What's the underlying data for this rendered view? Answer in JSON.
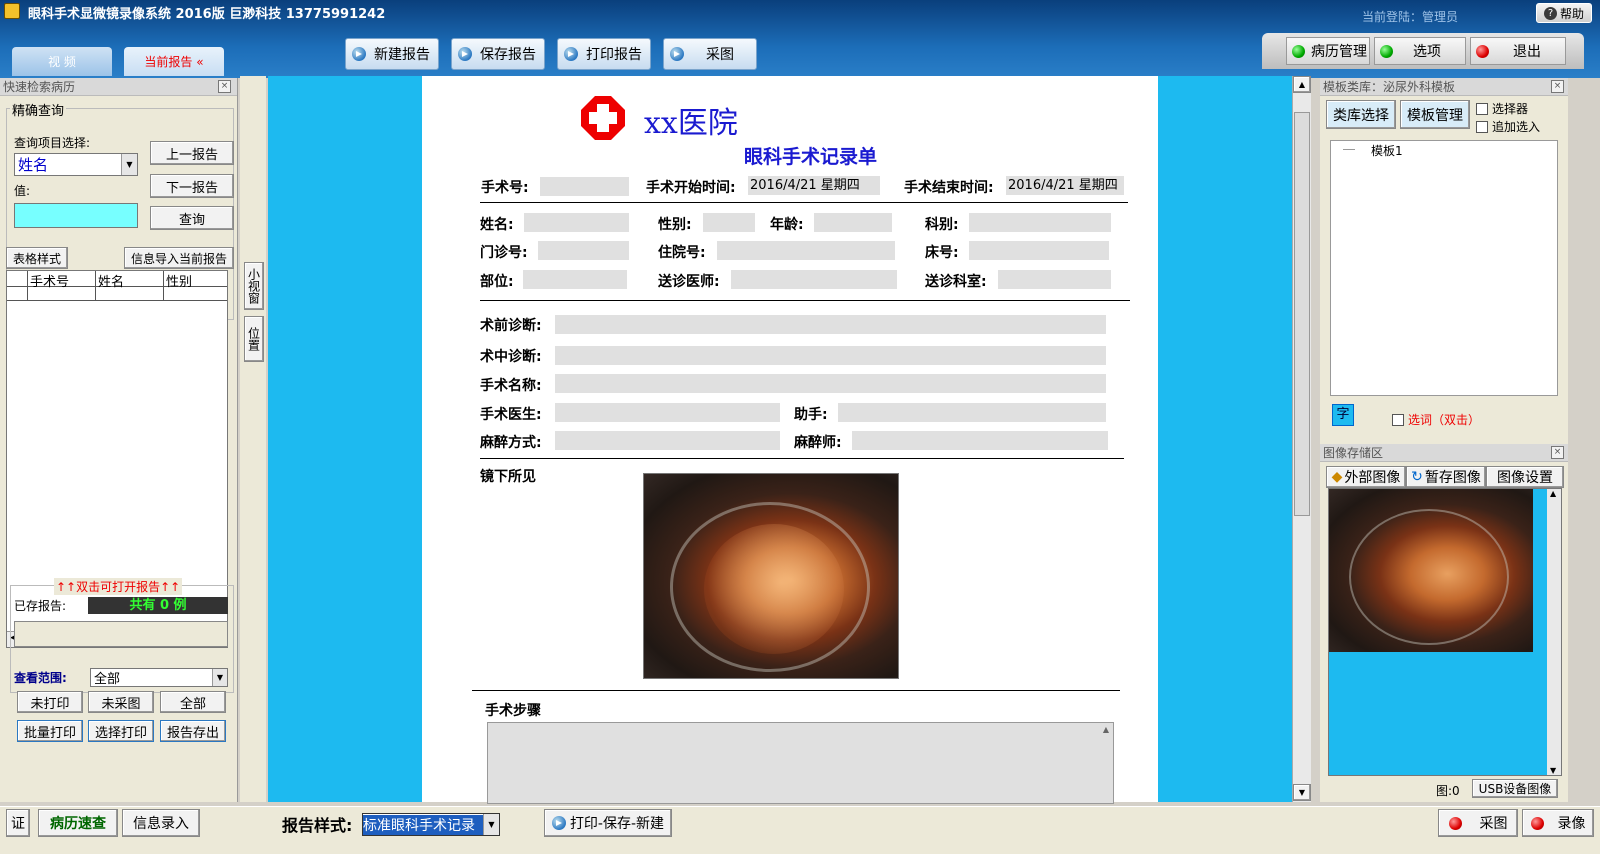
{
  "app": {
    "title": "眼科手术显微镜录像系统  2016版    巨渺科技    13775991242",
    "login": "当前登陆：管理员",
    "help": "帮助"
  },
  "tabs": {
    "video": "视 频",
    "current_report": "当前报告 «"
  },
  "toolbar": {
    "new_report": "新建报告",
    "save_report": "保存报告",
    "print_report": "打印报告",
    "capture": "采图"
  },
  "right_top": {
    "records": "病历管理",
    "options": "选项",
    "exit": "退出"
  },
  "left": {
    "title": "快速检索病历",
    "precise": "精确查询",
    "query_item_label": "查询项目选择:",
    "query_item_value": "姓名",
    "value_label": "值:",
    "prev": "上一报告",
    "next": "下一报告",
    "query": "查询",
    "table_style": "表格样式",
    "import_info": "信息导入当前报告",
    "columns": [
      "手术号",
      "姓名",
      "性别"
    ],
    "dblclick_hint": "↑↑双击可打开报告↑↑",
    "saved_label": "已存报告:",
    "saved_count": "共有 0 例",
    "scope_label": "查看范围:",
    "scope_value": "全部",
    "not_printed": "未打印",
    "not_captured": "未采图",
    "all": "全部",
    "batch_print": "批量打印",
    "select_print": "选择打印",
    "export": "报告存出"
  },
  "side_tabs": {
    "small_window": "小视窗",
    "position": "位置"
  },
  "report": {
    "hospital": "xx医院",
    "form_title": "眼科手术记录单",
    "surgery_no": "手术号:",
    "start_time_label": "手术开始时间:",
    "start_time": "2016/4/21  星期四",
    "end_time_label": "手术结束时间:",
    "end_time": "2016/4/21  星期四",
    "name": "姓名:",
    "gender": "性别:",
    "age": "年龄:",
    "dept": "科别:",
    "outpatient_no": "门诊号:",
    "inpatient_no": "住院号:",
    "bed_no": "床号:",
    "site": "部位:",
    "doctor": "送诊医师:",
    "referring_dept": "送诊科室:",
    "pre_diag": "术前诊断:",
    "intra_diag": "术中诊断:",
    "surgery_name": "手术名称:",
    "surgeon": "手术医生:",
    "assistant": "助手:",
    "anesthesia": "麻醉方式:",
    "anesthetist": "麻醉师:",
    "microscope_findings": "镜下所见",
    "steps": "手术步骤"
  },
  "right": {
    "template_title": "模板类库：泌尿外科模板",
    "lib_select": "类库选择",
    "template_mgr": "模板管理",
    "selector": "选择器",
    "append": "追加选入",
    "tree_item": "模板1",
    "font_btn": "字",
    "select_word": "选词（双击）",
    "image_store": "图像存储区",
    "external_image": "外部图像",
    "temp_image": "暂存图像",
    "image_settings": "图像设置",
    "image_count": "图:0",
    "usb_image": "USB设备图像"
  },
  "status": {
    "cert": "证",
    "quick_records": "病历速查",
    "info_entry": "信息录入",
    "report_style_label": "报告样式:",
    "report_style_value": "标准眼科手术记录",
    "print_save_new": "打印-保存-新建",
    "capture": "采图",
    "record": "录像"
  },
  "colors": {
    "accent_blue": "#1dbaf0",
    "title_blue": "#1c6db8",
    "red": "#e00000"
  }
}
